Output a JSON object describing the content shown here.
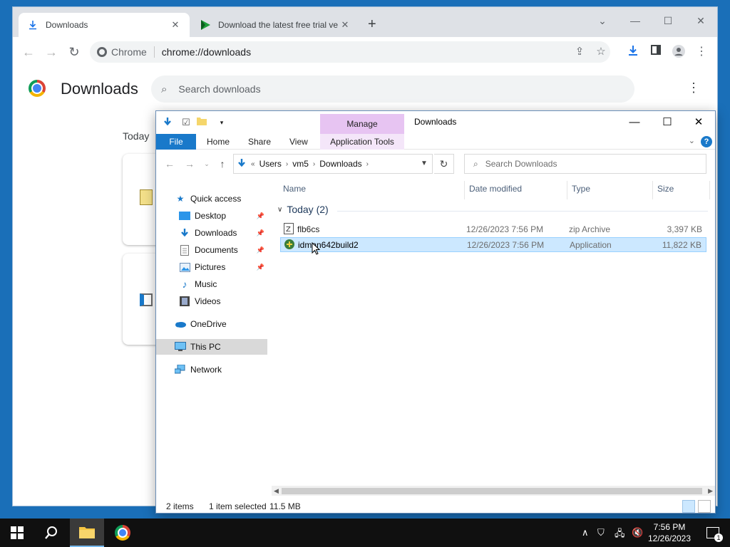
{
  "chrome": {
    "tabs": [
      {
        "title": "Downloads"
      },
      {
        "title": "Download the latest free trial ve"
      }
    ],
    "omnibox": {
      "site": "Chrome",
      "url": "chrome://downloads"
    },
    "page_title": "Downloads",
    "search_placeholder": "Search downloads",
    "today_label": "Today"
  },
  "explorer": {
    "manage_label": "Manage",
    "title": "Downloads",
    "ribbon_tabs": [
      "File",
      "Home",
      "Share",
      "View",
      "Application Tools"
    ],
    "breadcrumb": [
      "Users",
      "vm5",
      "Downloads"
    ],
    "search_placeholder": "Search Downloads",
    "nav": [
      {
        "label": "Quick access",
        "icon": "star-icon"
      },
      {
        "label": "Desktop",
        "icon": "desktop-icon",
        "pinned": true
      },
      {
        "label": "Downloads",
        "icon": "download-icon",
        "pinned": true
      },
      {
        "label": "Documents",
        "icon": "document-icon",
        "pinned": true
      },
      {
        "label": "Pictures",
        "icon": "pictures-icon",
        "pinned": true
      },
      {
        "label": "Music",
        "icon": "music-icon"
      },
      {
        "label": "Videos",
        "icon": "videos-icon"
      },
      {
        "label": "OneDrive",
        "icon": "cloud-icon"
      },
      {
        "label": "This PC",
        "icon": "computer-icon",
        "selected": true
      },
      {
        "label": "Network",
        "icon": "network-icon"
      }
    ],
    "columns": [
      "Name",
      "Date modified",
      "Type",
      "Size"
    ],
    "group_label": "Today (2)",
    "files": [
      {
        "name": "flb6cs",
        "date": "12/26/2023 7:56 PM",
        "type": "zip Archive",
        "size": "3,397 KB",
        "selected": false
      },
      {
        "name": "idman642build2",
        "date": "12/26/2023 7:56 PM",
        "type": "Application",
        "size": "11,822 KB",
        "selected": true
      }
    ],
    "status": {
      "items": "2 items",
      "selected": "1 item selected",
      "size": "11.5 MB"
    }
  },
  "taskbar": {
    "time": "7:56 PM",
    "date": "12/26/2023",
    "notification_count": "1"
  },
  "colors": {
    "desktop": "#1a6fb8",
    "file_tab": "#1979ca",
    "manage_tab": "#e7c4f2",
    "selection": "#cce8ff"
  }
}
